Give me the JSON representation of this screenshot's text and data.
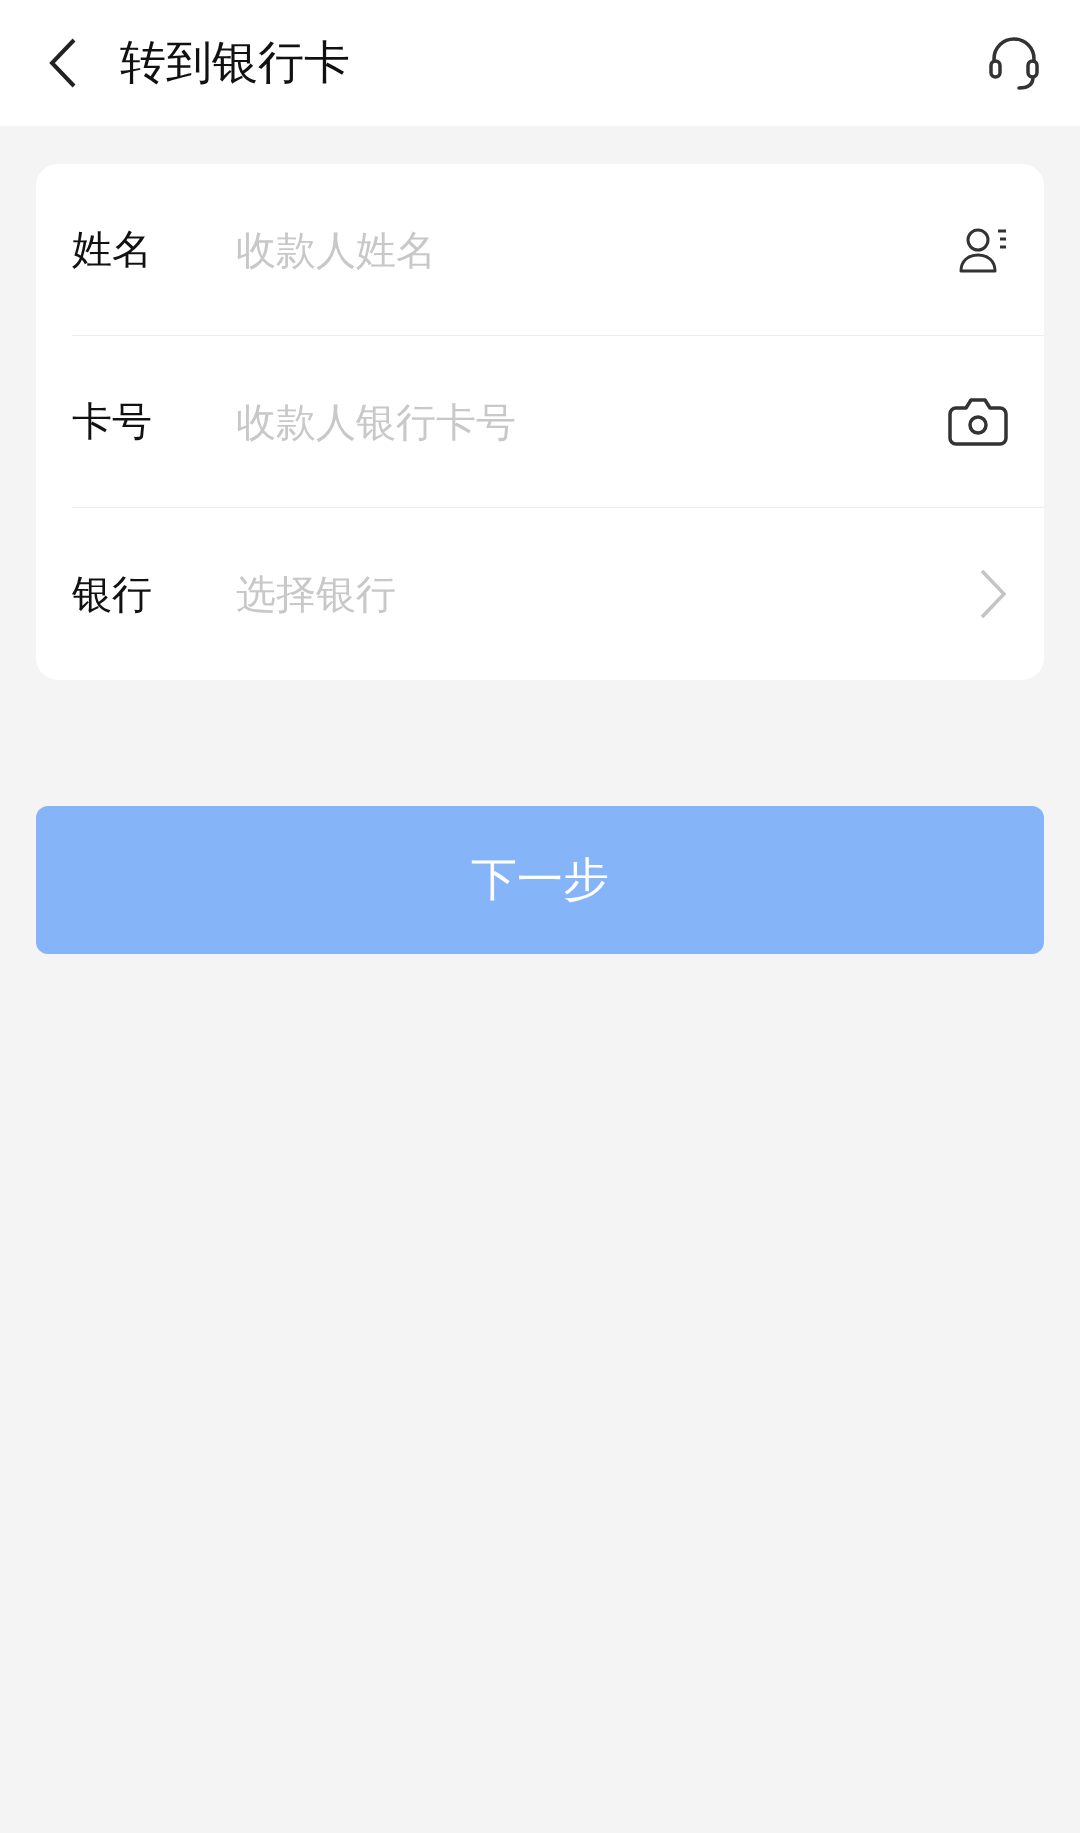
{
  "header": {
    "title": "转到银行卡"
  },
  "fields": [
    {
      "label": "姓名",
      "placeholder": "收款人姓名",
      "kind": "contact"
    },
    {
      "label": "卡号",
      "placeholder": "收款人银行卡号",
      "kind": "camera"
    },
    {
      "label": "银行",
      "placeholder": "选择银行",
      "kind": "select"
    }
  ],
  "next_button": {
    "label": "下一步",
    "disabled": true
  }
}
